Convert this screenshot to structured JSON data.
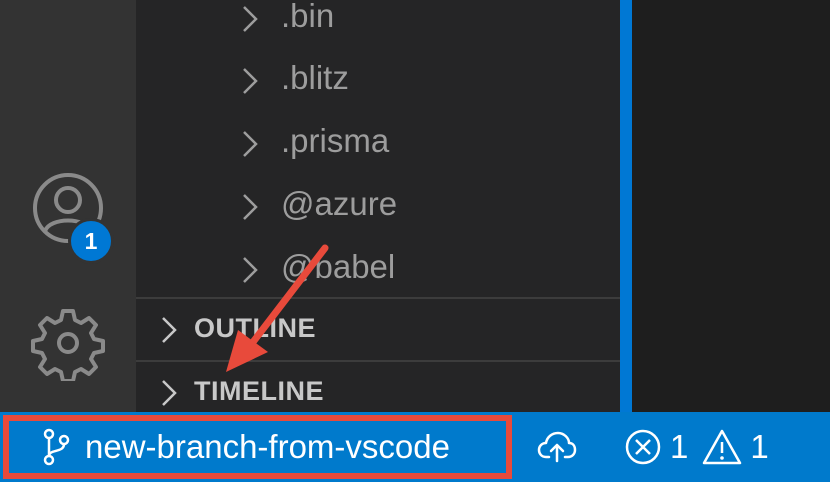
{
  "explorer": {
    "folders": [
      ".bin",
      ".blitz",
      ".prisma",
      "@azure",
      "@babel"
    ]
  },
  "sections": {
    "outline": "OUTLINE",
    "timeline": "TIMELINE"
  },
  "activity_bar": {
    "accounts_badge": "1",
    "accounts_icon": "person-circle",
    "settings_icon": "gear"
  },
  "status_bar": {
    "branch": "new-branch-from-vscode",
    "branch_icon": "git-branch",
    "sync_icon": "cloud-upload",
    "errors": "1",
    "warnings": "1"
  },
  "colors": {
    "status_bar": "#007acc",
    "highlight_box": "#e84a3b",
    "annotation_arrow": "#e84a3b",
    "badge": "#0078d4"
  }
}
